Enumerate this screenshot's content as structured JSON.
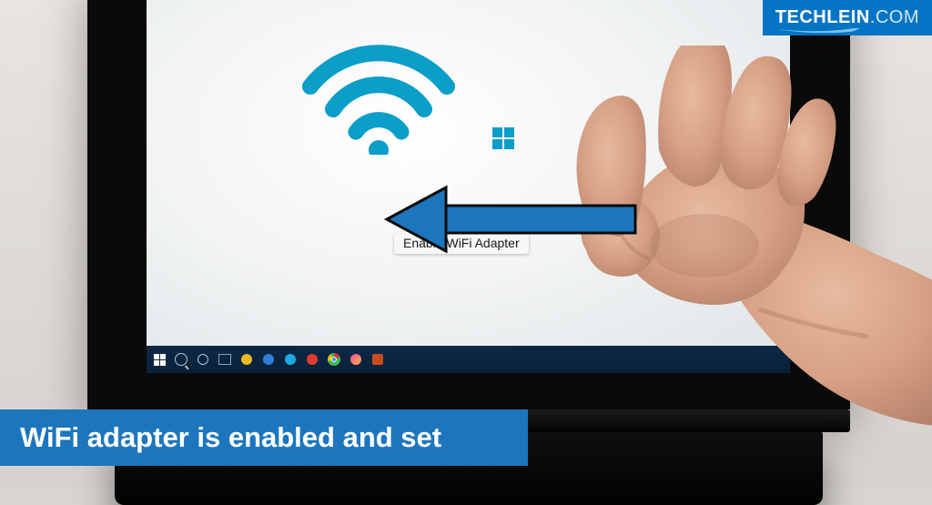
{
  "logo": {
    "brand_bold": "TECHLEIN",
    "brand_thin": ".COM"
  },
  "caption": {
    "text": "WiFi adapter is enabled and set"
  },
  "screen": {
    "enable_label": "Enable WiFi Adapter"
  },
  "colors": {
    "accent_blue": "#1d76bd",
    "wifi_blue": "#0b9ec9",
    "logo_blue": "#0674c4"
  }
}
